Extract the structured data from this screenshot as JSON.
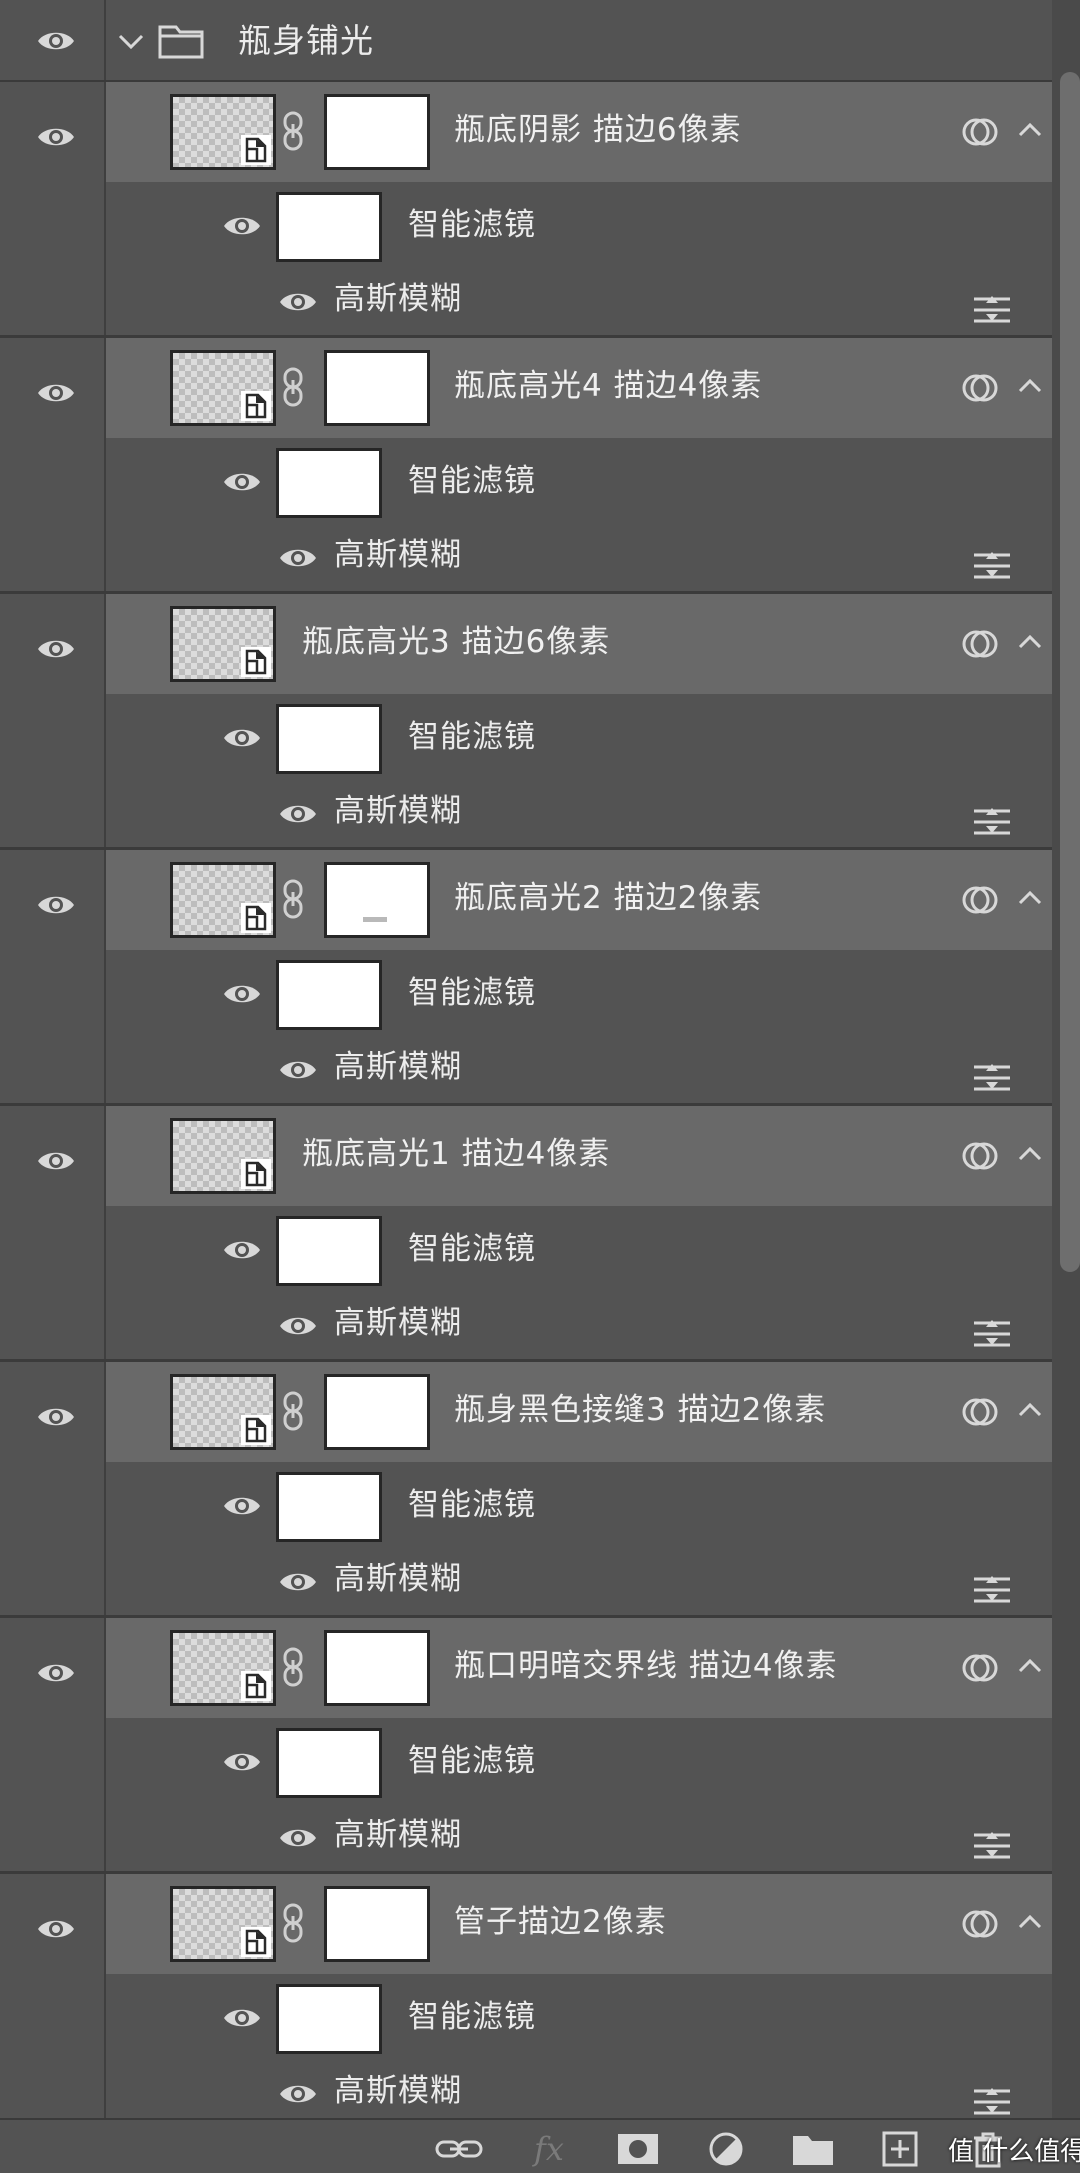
{
  "group": {
    "name": "瓶身铺光",
    "expanded": true
  },
  "filter_label": "智能滤镜",
  "blur_label": "高斯模糊",
  "layers": [
    {
      "name": "瓶底阴影 描边6像素",
      "has_mask": true,
      "mask_mark": false
    },
    {
      "name": "瓶底高光4 描边4像素",
      "has_mask": true,
      "mask_mark": false
    },
    {
      "name": "瓶底高光3 描边6像素",
      "has_mask": false,
      "mask_mark": false
    },
    {
      "name": "瓶底高光2 描边2像素",
      "has_mask": true,
      "mask_mark": true
    },
    {
      "name": "瓶底高光1 描边4像素",
      "has_mask": false,
      "mask_mark": false
    },
    {
      "name": "瓶身黑色接缝3 描边2像素",
      "has_mask": true,
      "mask_mark": false
    },
    {
      "name": "瓶口明暗交界线 描边4像素",
      "has_mask": true,
      "mask_mark": false
    },
    {
      "name": "管子描边2像素",
      "has_mask": true,
      "mask_mark": false
    }
  ],
  "toolbar": {
    "icons": [
      "link-layers-icon",
      "fx-icon",
      "add-mask-icon",
      "adjustment-layer-icon",
      "new-group-icon",
      "new-layer-icon",
      "delete-layer-icon"
    ],
    "fx_label": "fx"
  },
  "watermark": "值 什么值得买",
  "colors": {
    "panel_bg": "#535353",
    "layer_row_bg": "#696969",
    "text": "#ececec"
  }
}
